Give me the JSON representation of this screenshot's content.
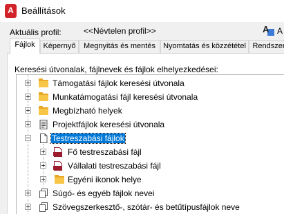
{
  "window": {
    "title": "Beállítások",
    "app_icon_letter": "A"
  },
  "profile": {
    "label": "Aktuális profil:",
    "value": "<<Névtelen profil>>",
    "cut_text": "A"
  },
  "tabs": [
    {
      "label": "Fájlok",
      "active": true
    },
    {
      "label": "Képernyő",
      "active": false
    },
    {
      "label": "Megnyitás és mentés",
      "active": false
    },
    {
      "label": "Nyomtatás és közzététel",
      "active": false
    },
    {
      "label": "Rendszer",
      "active": false
    }
  ],
  "panel": {
    "section_label": "Keresési útvonalak, fájlnevek és fájlok elhelyezkedései:"
  },
  "tree": {
    "items": [
      {
        "label": "Támogatási fájlok keresési útvonala",
        "icon": "folder-icon"
      },
      {
        "label": "Munkatámogatási fájl keresési útvonala",
        "icon": "folder-icon"
      },
      {
        "label": "Megbízható helyek",
        "icon": "folder-icon"
      },
      {
        "label": "Projektfájlok keresési útvonala",
        "icon": "project-files-icon"
      },
      {
        "label": "Testreszabási fájlok",
        "icon": "document-icon",
        "selected": true
      },
      {
        "label": "Fő testreszabási fájl",
        "icon": "cuix-file-icon"
      },
      {
        "label": "Vállalati testreszabási fájl",
        "icon": "cuix-file-icon"
      },
      {
        "label": "Egyéni ikonok helye",
        "icon": "folder-icon"
      },
      {
        "label": "Súgó- és egyéb fájlok nevei",
        "icon": "documents-icon"
      },
      {
        "label": "Szövegszerkesztő-, szótár- és betűtípusfájlok neve",
        "icon": "documents-icon"
      }
    ],
    "cuix_badge": "CUIX"
  },
  "colors": {
    "selection": "#0078d7",
    "folder": "#f8c647",
    "cuix": "#9b1c2c",
    "app_icon": "#d3232a"
  }
}
